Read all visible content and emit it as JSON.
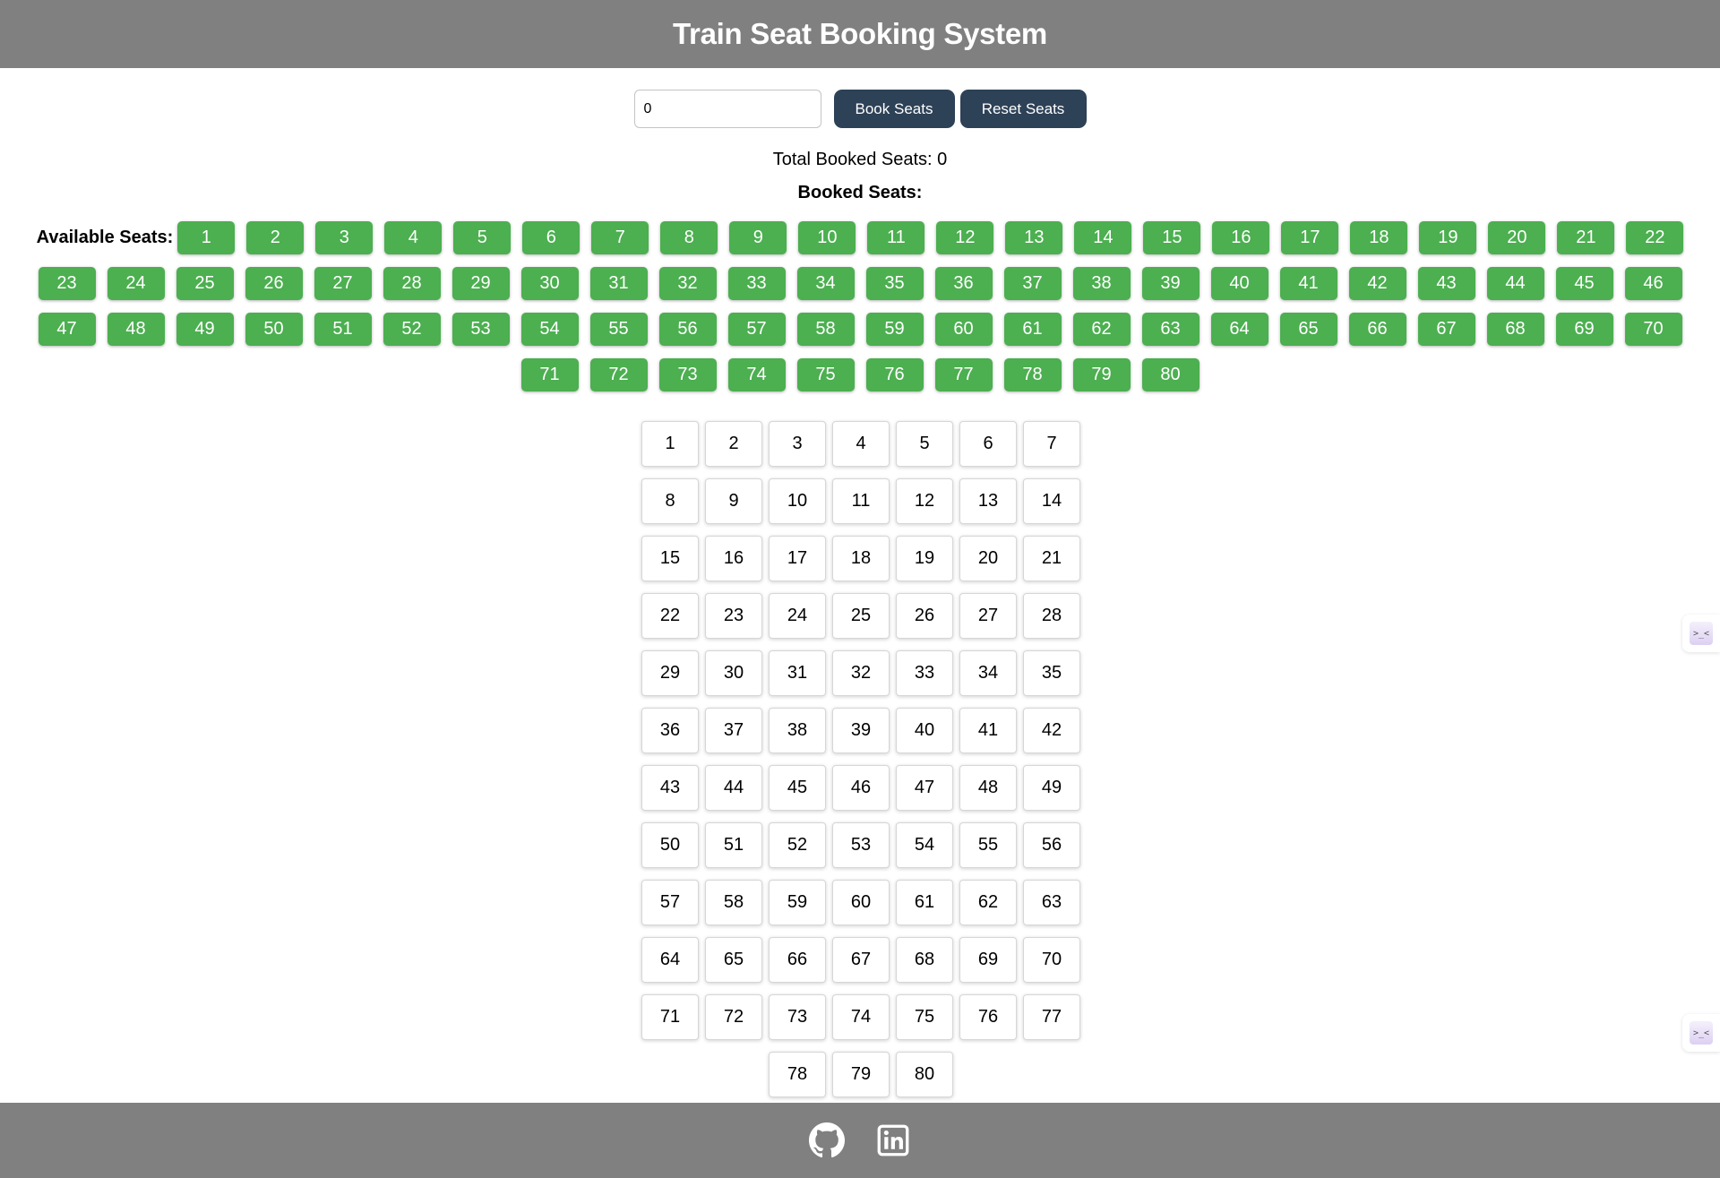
{
  "header": {
    "title": "Train Seat Booking System"
  },
  "controls": {
    "seat_count_value": "0",
    "book_label": "Book Seats",
    "reset_label": "Reset Seats"
  },
  "summary": {
    "total_booked_text": "Total Booked Seats: 0",
    "booked_seats_label": "Booked Seats:"
  },
  "available": {
    "label": "Available Seats:",
    "seats": [
      "1",
      "2",
      "3",
      "4",
      "5",
      "6",
      "7",
      "8",
      "9",
      "10",
      "11",
      "12",
      "13",
      "14",
      "15",
      "16",
      "17",
      "18",
      "19",
      "20",
      "21",
      "22",
      "23",
      "24",
      "25",
      "26",
      "27",
      "28",
      "29",
      "30",
      "31",
      "32",
      "33",
      "34",
      "35",
      "36",
      "37",
      "38",
      "39",
      "40",
      "41",
      "42",
      "43",
      "44",
      "45",
      "46",
      "47",
      "48",
      "49",
      "50",
      "51",
      "52",
      "53",
      "54",
      "55",
      "56",
      "57",
      "58",
      "59",
      "60",
      "61",
      "62",
      "63",
      "64",
      "65",
      "66",
      "67",
      "68",
      "69",
      "70",
      "71",
      "72",
      "73",
      "74",
      "75",
      "76",
      "77",
      "78",
      "79",
      "80"
    ]
  },
  "seat_map": {
    "seats": [
      "1",
      "2",
      "3",
      "4",
      "5",
      "6",
      "7",
      "8",
      "9",
      "10",
      "11",
      "12",
      "13",
      "14",
      "15",
      "16",
      "17",
      "18",
      "19",
      "20",
      "21",
      "22",
      "23",
      "24",
      "25",
      "26",
      "27",
      "28",
      "29",
      "30",
      "31",
      "32",
      "33",
      "34",
      "35",
      "36",
      "37",
      "38",
      "39",
      "40",
      "41",
      "42",
      "43",
      "44",
      "45",
      "46",
      "47",
      "48",
      "49",
      "50",
      "51",
      "52",
      "53",
      "54",
      "55",
      "56",
      "57",
      "58",
      "59",
      "60",
      "61",
      "62",
      "63",
      "64",
      "65",
      "66",
      "67",
      "68",
      "69",
      "70",
      "71",
      "72",
      "73",
      "74",
      "75",
      "76",
      "77",
      "78",
      "79",
      "80"
    ]
  },
  "side_tabs": [
    {
      "icon": "extension-icon",
      "glyph": ">_<"
    },
    {
      "icon": "extension-icon",
      "glyph": ">_<"
    }
  ],
  "footer": {
    "links": [
      {
        "icon": "github-icon"
      },
      {
        "icon": "linkedin-icon"
      }
    ]
  },
  "colors": {
    "header_bg": "#808080",
    "footer_bg": "#808080",
    "button_bg": "#2d4157",
    "available_seat": "#4caf50"
  }
}
